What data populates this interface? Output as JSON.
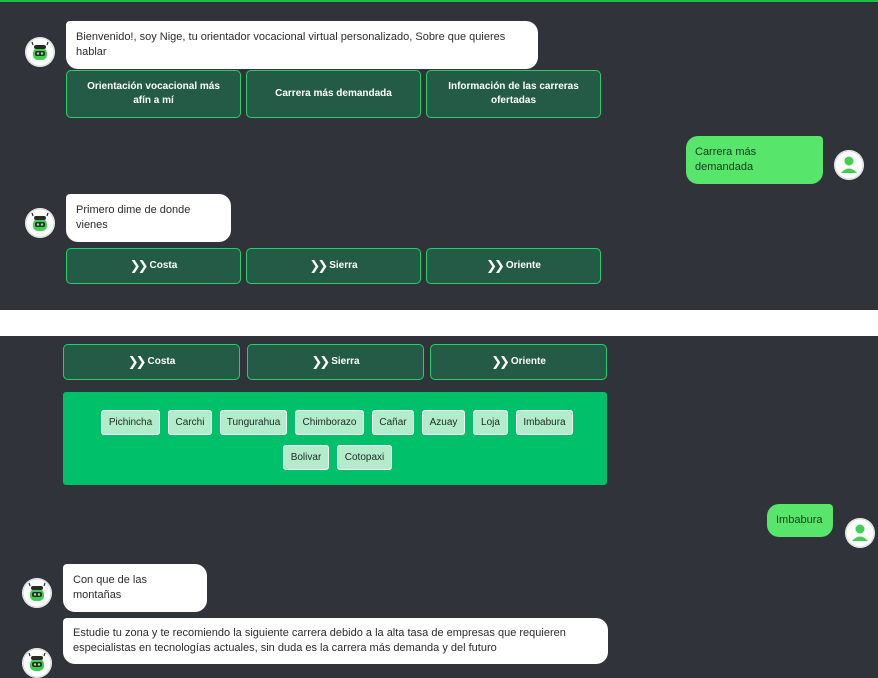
{
  "colors": {
    "panel_bg": "#30343a",
    "accent_green": "#1fbf46",
    "user_bubble": "#57e56b",
    "option_bg": "#245b46",
    "option_border": "#24d06a",
    "province_panel": "#00c06a",
    "chip_bg": "#b2eccb"
  },
  "top": {
    "bot_greeting": "Bienvenido!, soy Nige, tu orientador vocacional virtual personalizado, Sobre que quieres hablar",
    "options": [
      "Orientación vocacional más afín a mí",
      "Carrera más demandada",
      "Información de las carreras ofertadas"
    ],
    "user_reply": "Carrera más demandada",
    "bot_question": "Primero dime de donde vienes",
    "regions": [
      "Costa",
      "Sierra",
      "Oriente"
    ]
  },
  "bottom": {
    "regions": [
      "Costa",
      "Sierra",
      "Oriente"
    ],
    "provinces": [
      "Pichincha",
      "Carchi",
      "Tungurahua",
      "Chimborazo",
      "Cañar",
      "Azuay",
      "Loja",
      "Imbabura",
      "Bolivar",
      "Cotopaxi"
    ],
    "user_reply": "Imbabura",
    "bot_msg_1": "Con que de las montañas",
    "bot_msg_2_line1": "Estudie tu zona y te recomiendo la siguiente carrera debido a la alta tasa de empresas que requieren",
    "bot_msg_2_line2": "especialistas en tecnologías actuales, sin duda es la carrera más demanda y del futuro"
  },
  "icons": {
    "bot": "robot-avatar-icon",
    "user": "user-avatar-icon",
    "region_button": "double-chevron-right-icon"
  }
}
